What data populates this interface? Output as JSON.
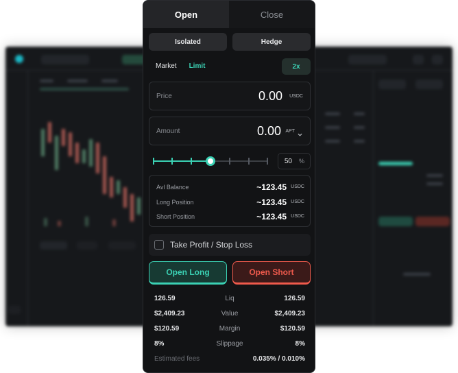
{
  "tabs": [
    {
      "label": "Open",
      "active": true
    },
    {
      "label": "Close",
      "active": false
    }
  ],
  "margin_mode": {
    "isolated_label": "Isolated",
    "hedge_label": "Hedge"
  },
  "order_type": {
    "market_label": "Market",
    "limit_label": "Limit",
    "selected": "Limit"
  },
  "leverage": {
    "label": "2x"
  },
  "price_field": {
    "label": "Price",
    "value": "0.00",
    "unit": "USDC"
  },
  "amount_field": {
    "label": "Amount",
    "value": "0.00",
    "unit": "APT",
    "unit_icon": "chevron-down-icon"
  },
  "slider": {
    "percent_value": "50",
    "percent_symbol": "%",
    "level": 0.5
  },
  "balances": [
    {
      "label": "Avl Balance",
      "value": "~123.45",
      "unit": "USDC"
    },
    {
      "label": "Long Position",
      "value": "~123.45",
      "unit": "USDC"
    },
    {
      "label": "Short Position",
      "value": "~123.45",
      "unit": "USDC"
    }
  ],
  "tpsl": {
    "label": "Take Profit / Stop Loss",
    "checked": false
  },
  "actions": {
    "open_long_label": "Open Long",
    "open_short_label": "Open Short"
  },
  "summary": [
    {
      "left": "126.59",
      "label": "Liq",
      "right": "126.59"
    },
    {
      "left": "$2,409.23",
      "label": "Value",
      "right": "$2,409.23"
    },
    {
      "left": "$120.59",
      "label": "Margin",
      "right": "$120.59"
    },
    {
      "left": "8%",
      "label": "Slippage",
      "right": "8%"
    }
  ],
  "fees": {
    "label": "Estimated fees",
    "value": "0.035% / 0.010%"
  },
  "colors": {
    "accent_green": "#3bd1b4",
    "accent_red": "#ef5a4c",
    "panel_bg": "#121315"
  }
}
